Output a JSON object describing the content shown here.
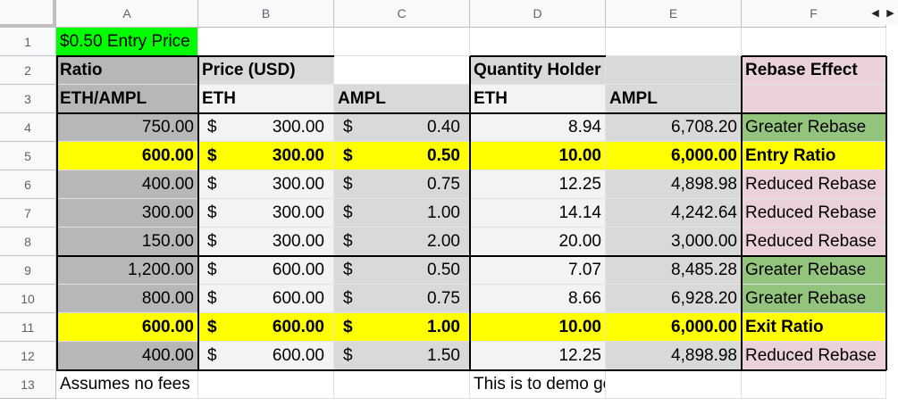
{
  "columns": [
    "A",
    "B",
    "C",
    "D",
    "E",
    "F"
  ],
  "rows": [
    "1",
    "2",
    "3",
    "4",
    "5",
    "6",
    "7",
    "8",
    "9",
    "10",
    "11",
    "12",
    "13"
  ],
  "cells": {
    "A1": "$0.50 Entry Price",
    "A2": "Ratio",
    "B2": "Price (USD)",
    "D2": "Quantity Holder",
    "F2": "Rebase Effect",
    "A3": "ETH/AMPL",
    "B3": "ETH",
    "C3": "AMPL",
    "D3": "ETH",
    "E3": "AMPL",
    "A4": "750.00",
    "B4": "300.00",
    "C4": "0.40",
    "D4": "8.94",
    "E4": "6,708.20",
    "F4": "Greater Rebase",
    "A5": "600.00",
    "B5": "300.00",
    "C5": "0.50",
    "D5": "10.00",
    "E5": "6,000.00",
    "F5": "Entry Ratio",
    "A6": "400.00",
    "B6": "300.00",
    "C6": "0.75",
    "D6": "12.25",
    "E6": "4,898.98",
    "F6": "Reduced Rebase",
    "A7": "300.00",
    "B7": "300.00",
    "C7": "1.00",
    "D7": "14.14",
    "E7": "4,242.64",
    "F7": "Reduced Rebase",
    "A8": "150.00",
    "B8": "300.00",
    "C8": "2.00",
    "D8": "20.00",
    "E8": "3,000.00",
    "F8": "Reduced Rebase",
    "A9": "1,200.00",
    "B9": "600.00",
    "C9": "0.50",
    "D9": "7.07",
    "E9": "8,485.28",
    "F9": "Greater Rebase",
    "A10": "800.00",
    "B10": "600.00",
    "C10": "0.75",
    "D10": "8.66",
    "E10": "6,928.20",
    "F10": "Greater Rebase",
    "A11": "600.00",
    "B11": "600.00",
    "C11": "1.00",
    "D11": "10.00",
    "E11": "6,000.00",
    "F11": "Exit Ratio",
    "A12": "400.00",
    "B12": "600.00",
    "C12": "1.50",
    "D12": "12.25",
    "E12": "4,898.98",
    "F12": "Reduced Rebase",
    "A13": "Assumes no fees",
    "D13": "This is to demo general ratio dynamics only"
  },
  "currency_symbol": "$",
  "colors": {
    "entry_green": "#00ff00",
    "highlight_yellow": "#ffff00",
    "header_gray": "#d9d9d9",
    "col_a_gray": "#b7b7b7",
    "light_gray": "#f3f3f3",
    "mid_gray": "#d9d9d9",
    "greater_green": "#93c47d",
    "reduced_pink": "#ead1dc"
  },
  "scroll_arrows": {
    "left": "◀",
    "right": "▶"
  }
}
